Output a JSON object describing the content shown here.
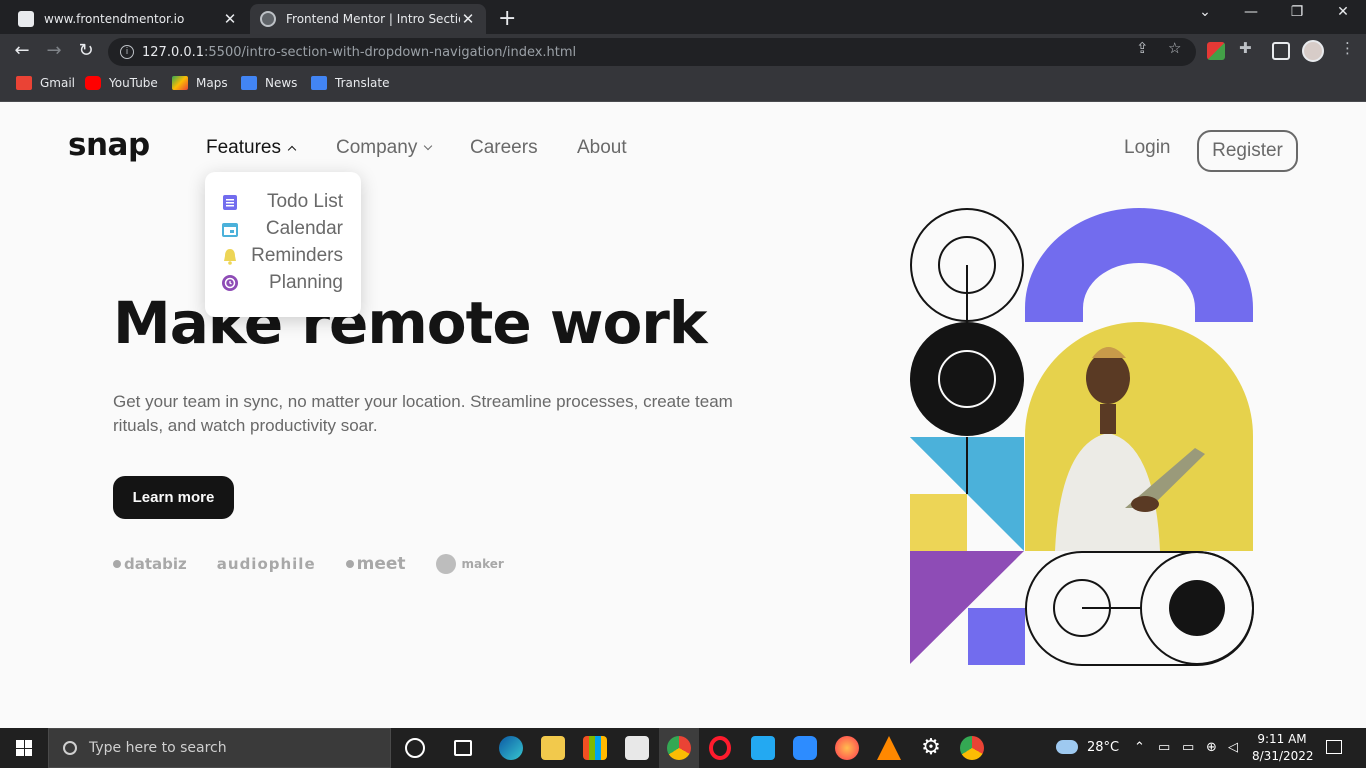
{
  "browser": {
    "tabs": [
      {
        "title": "www.frontendmentor.io"
      },
      {
        "title": "Frontend Mentor | Intro Section W"
      }
    ],
    "url_host": "127.0.0.1",
    "url_path": ":5500/intro-section-with-dropdown-navigation/index.html",
    "bookmarks": [
      {
        "label": "Gmail",
        "color": "#ea4335"
      },
      {
        "label": "YouTube",
        "color": "#ff0000"
      },
      {
        "label": "Maps",
        "color": "#34a853"
      },
      {
        "label": "News",
        "color": "#4285f4"
      },
      {
        "label": "Translate",
        "color": "#4285f4"
      }
    ]
  },
  "site": {
    "logo": "snap",
    "nav": [
      {
        "label": "Features",
        "dropdown": "open"
      },
      {
        "label": "Company",
        "dropdown": "closed"
      },
      {
        "label": "Careers"
      },
      {
        "label": "About"
      }
    ],
    "login": "Login",
    "register": "Register",
    "features_menu": [
      {
        "label": "Todo List",
        "icon": "todo-icon",
        "color": "#726CEE"
      },
      {
        "label": "Calendar",
        "icon": "calendar-icon",
        "color": "#4BB1DA"
      },
      {
        "label": "Reminders",
        "icon": "bell-icon",
        "color": "#EDD556"
      },
      {
        "label": "Planning",
        "icon": "clock-icon",
        "color": "#8E4CB6"
      }
    ],
    "headline": "Make remote work",
    "subtext": "Get your team in sync, no matter your location. Streamline processes, create team rituals, and watch productivity soar.",
    "cta": "Learn more",
    "clients": [
      "databiz",
      "audiophile",
      "meet",
      "maker"
    ]
  },
  "taskbar": {
    "search_placeholder": "Type here to search",
    "weather": "28°C",
    "time": "9:11 AM",
    "date": "8/31/2022"
  },
  "colors": {
    "dark": "#141414",
    "gray": "#696969",
    "violet": "#726CEE",
    "yellow": "#EDD556",
    "blue": "#4BB1DA",
    "purple": "#8E4CB6"
  }
}
